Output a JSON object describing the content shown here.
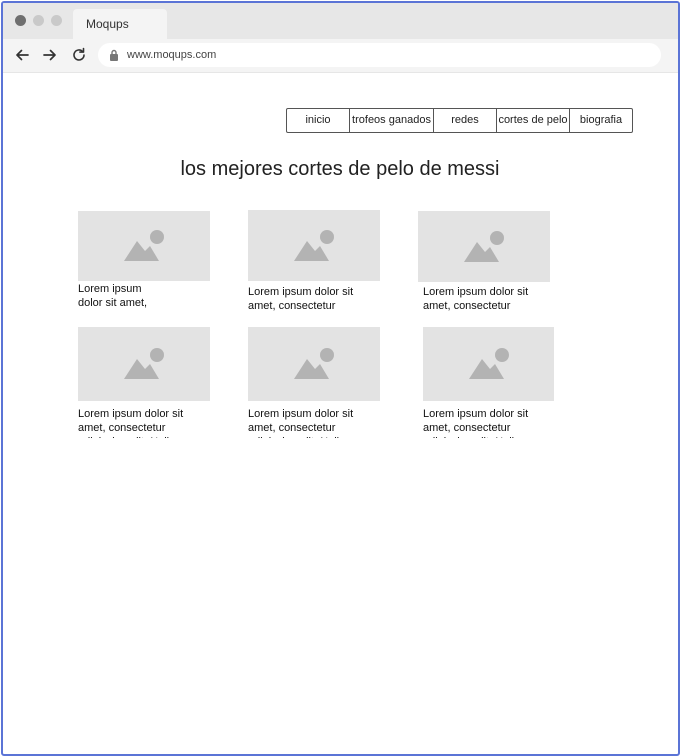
{
  "browser": {
    "tab_title": "Moqups",
    "url": "www.moqups.com"
  },
  "nav": {
    "items": [
      {
        "label": "inicio"
      },
      {
        "label": "trofeos ganados"
      },
      {
        "label": "redes"
      },
      {
        "label": "cortes de pelo"
      },
      {
        "label": "biografia"
      }
    ]
  },
  "page": {
    "title": "los mejores cortes de pelo de messi"
  },
  "cards": [
    {
      "caption": "Lorem ipsum\ndolor sit amet,"
    },
    {
      "caption": "Lorem ipsum dolor sit\namet, consectetur"
    },
    {
      "caption": "Lorem ipsum dolor sit\namet, consectetur"
    },
    {
      "caption": "Lorem ipsum dolor sit\namet, consectetur\nadipiscing elit. Nulla"
    },
    {
      "caption": "Lorem ipsum dolor sit\namet, consectetur\nadipiscing elit. Nulla"
    },
    {
      "caption": "Lorem ipsum dolor sit\namet, consectetur\nadipiscing elit. Nulla"
    }
  ],
  "icons": {
    "back": "arrow-left-icon",
    "forward": "arrow-right-icon",
    "reload": "reload-icon",
    "lock": "lock-icon",
    "image_placeholder": "image-placeholder-icon"
  },
  "colors": {
    "frame_border": "#5b74d6",
    "placeholder_bg": "#e3e3e3",
    "placeholder_icon": "#b3b3b3"
  }
}
